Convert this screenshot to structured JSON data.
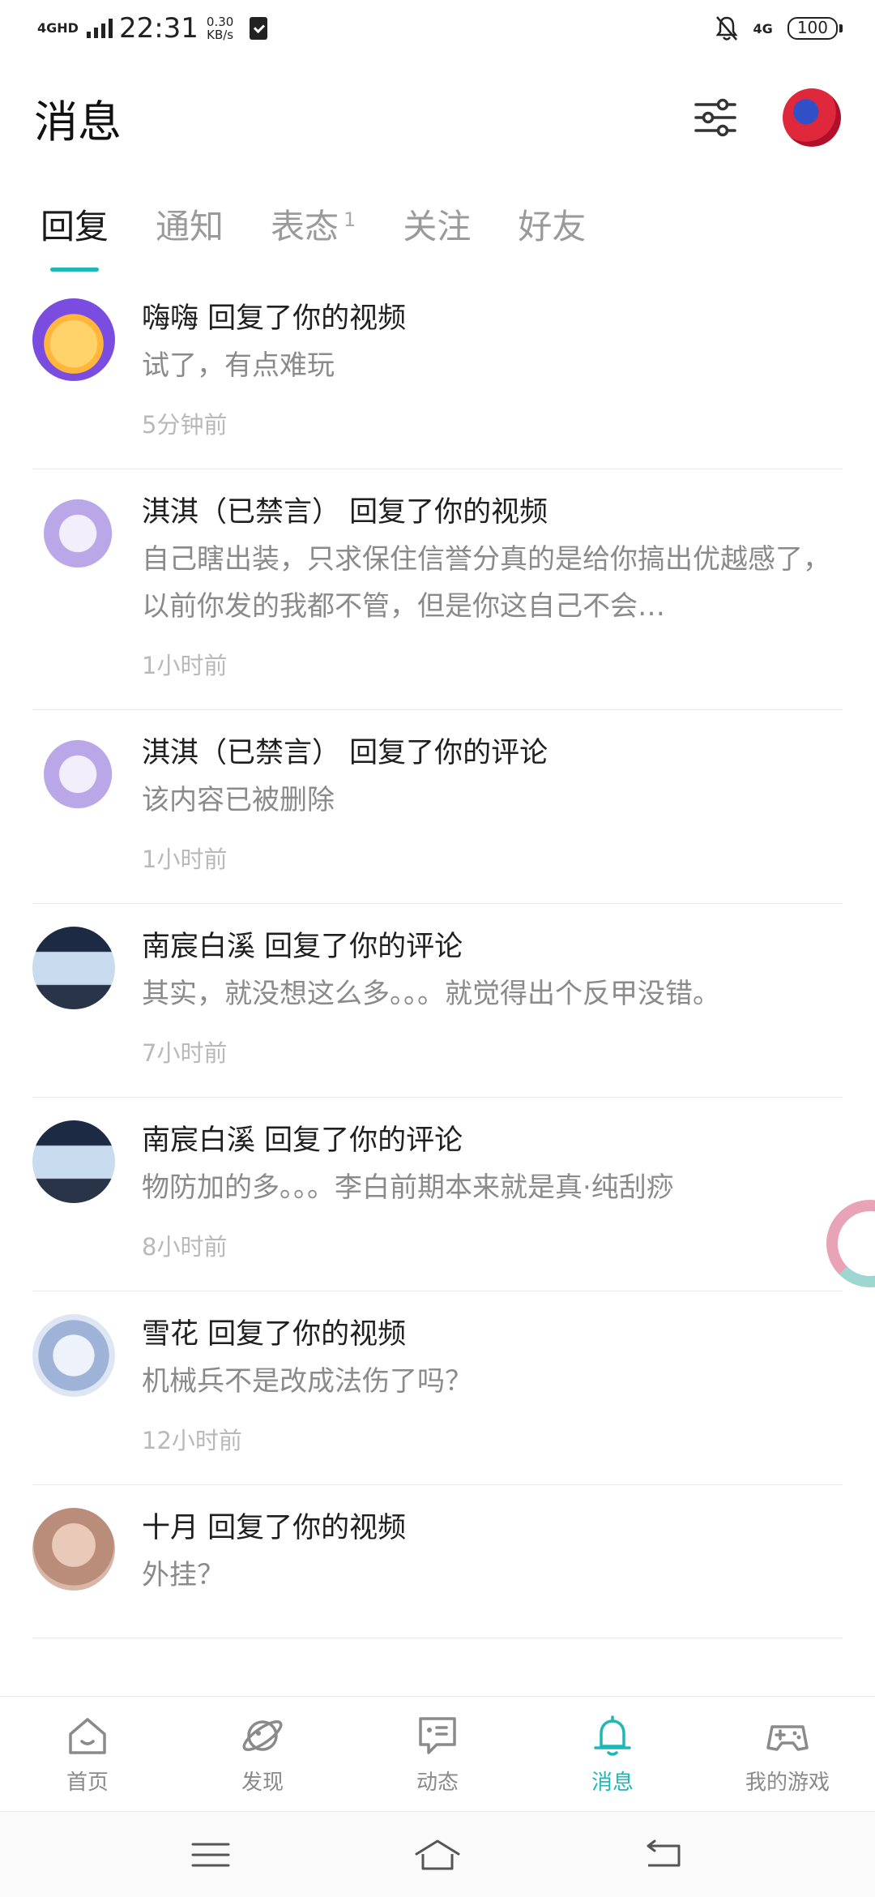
{
  "status_bar": {
    "network": "4GHD",
    "time": "22:31",
    "speed_value": "0.30",
    "speed_unit": "KB/s",
    "network_right": "4G",
    "battery": "100"
  },
  "header": {
    "title": "消息",
    "filter_icon": "filter-sliders-icon"
  },
  "tabs": [
    {
      "label": "回复",
      "active": true,
      "badge": ""
    },
    {
      "label": "通知",
      "active": false,
      "badge": ""
    },
    {
      "label": "表态",
      "active": false,
      "badge": "1"
    },
    {
      "label": "关注",
      "active": false,
      "badge": ""
    },
    {
      "label": "好友",
      "active": false,
      "badge": ""
    }
  ],
  "messages": [
    {
      "title": "嗨嗨 回复了你的视频",
      "body": "试了，有点难玩",
      "time": "5分钟前"
    },
    {
      "title": "淇淇（已禁言） 回复了你的视频",
      "body": "自己瞎出装，只求保住信誉分真的是给你搞出优越感了，以前你发的我都不管，但是你这自己不会…",
      "time": "1小时前"
    },
    {
      "title": "淇淇（已禁言） 回复了你的评论",
      "body": "该内容已被删除",
      "time": "1小时前"
    },
    {
      "title": "南宸白溪 回复了你的评论",
      "body": "其实，就没想这么多。。。就觉得出个反甲没错。",
      "time": "7小时前"
    },
    {
      "title": "南宸白溪 回复了你的评论",
      "body": "物防加的多。。。李白前期本来就是真·纯刮痧",
      "time": "8小时前"
    },
    {
      "title": "雪花 回复了你的视频",
      "body": "机械兵不是改成法伤了吗？",
      "time": "12小时前"
    },
    {
      "title": "十月 回复了你的视频",
      "body": "外挂？",
      "time": ""
    }
  ],
  "bottom_nav": [
    {
      "label": "首页",
      "icon": "home-icon",
      "active": false
    },
    {
      "label": "发现",
      "icon": "planet-icon",
      "active": false
    },
    {
      "label": "动态",
      "icon": "chat-bubble-icon",
      "active": false
    },
    {
      "label": "消息",
      "icon": "bell-icon",
      "active": true
    },
    {
      "label": "我的游戏",
      "icon": "gamepad-icon",
      "active": false
    }
  ],
  "colors": {
    "accent": "#1fb7b7",
    "muted_text": "#8a8a8a",
    "time_text": "#b9b9b9"
  }
}
